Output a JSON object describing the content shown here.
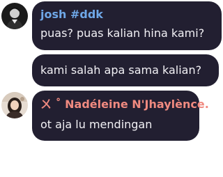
{
  "messages": [
    {
      "author": "josh #ddk",
      "author_color": "#6fa8e8",
      "lines": [
        "puas? puas kalian hina kami?",
        "kami salah apa sama kalian?"
      ]
    },
    {
      "author": "ㄨ ˚ Nadéleine N'Jhaylènce.",
      "author_color": "#f08a80",
      "lines": [
        "ot aja lu mendingan"
      ]
    }
  ],
  "colors": {
    "bubble": "#221f31",
    "text": "#f2f1f5"
  }
}
